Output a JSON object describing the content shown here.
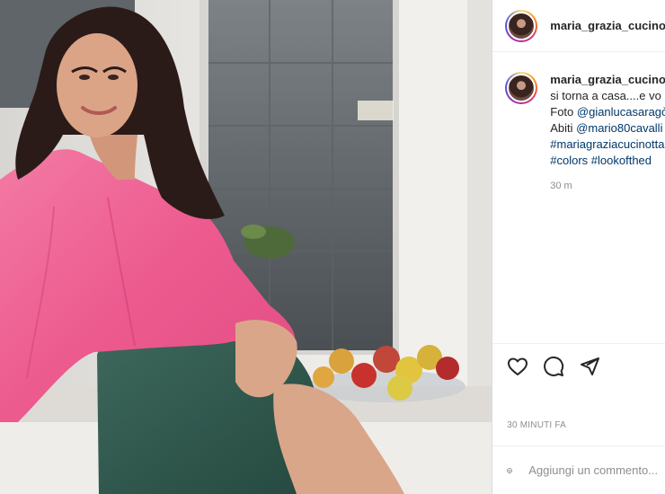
{
  "post": {
    "username": "maria_grazia_cucinotta",
    "caption": {
      "username": "maria_grazia_cucinotta",
      "lines": [
        "si torna a casa....e vo",
        "Foto @gianlucasaragò",
        "Abiti @mario80cavalli",
        "#mariagraziacucinotta",
        "#colors #lookofthed"
      ],
      "line_prefixes": [
        "",
        "Foto ",
        "Abiti ",
        "",
        ""
      ],
      "line_links": [
        "",
        "@gianlucasaragò",
        "@mario80cavalli",
        "#mariagraziacucinotta",
        "#colors #lookofthed"
      ],
      "line_plain": [
        "si torna a casa....e vo",
        "",
        "",
        "",
        ""
      ],
      "time": "30 m"
    },
    "actions": {
      "like_icon": "heart-icon",
      "comment_icon": "comment-icon",
      "share_icon": "share-icon"
    },
    "timestamp": "30 MINUTI FA",
    "comment_box": {
      "emoji_icon": "emoji-icon",
      "placeholder": "Aggiungi un commento..."
    }
  }
}
